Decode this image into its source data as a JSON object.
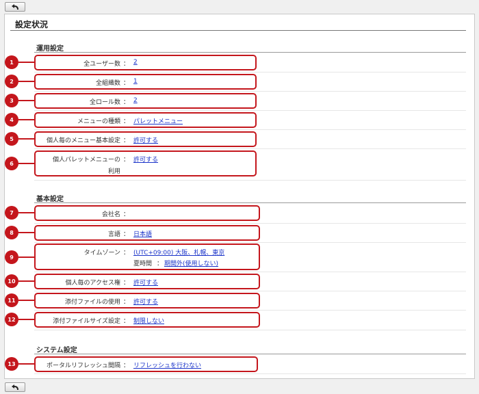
{
  "page_title": "設定状況",
  "sections": {
    "operation": "運用設定",
    "basic": "基本設定",
    "system": "システム設定"
  },
  "items": [
    {
      "num": "1",
      "label": "全ユーザー数",
      "value": "2"
    },
    {
      "num": "2",
      "label": "全組織数",
      "value": "1"
    },
    {
      "num": "3",
      "label": "全ロール数",
      "value": "2"
    },
    {
      "num": "4",
      "label": "メニューの種類",
      "value": "パレットメニュー"
    },
    {
      "num": "5",
      "label": "個人毎のメニュー基本設定",
      "value": "許可する"
    },
    {
      "num": "6",
      "label_line1": "個人パレットメニューの",
      "label_line2": "利用",
      "value": "許可する"
    },
    {
      "num": "7",
      "label": "会社名",
      "value": ""
    },
    {
      "num": "8",
      "label": "言語",
      "value": "日本語"
    },
    {
      "num": "9",
      "label": "タイムゾーン",
      "value": "(UTC+09:00) 大阪、札幌、東京",
      "sub_label": "夏時間",
      "sub_value": "期間外(使用しない)"
    },
    {
      "num": "10",
      "label": "個人毎のアクセス権",
      "value": "許可する"
    },
    {
      "num": "11",
      "label": "添付ファイルの使用",
      "value": "許可する"
    },
    {
      "num": "12",
      "label": "添付ファイルサイズ設定",
      "value": "制限しない"
    },
    {
      "num": "13",
      "label": "ポータルリフレッシュ間隔",
      "value": "リフレッシュを行わない"
    }
  ],
  "colon": "：",
  "icons": {
    "back": "back-arrow-icon"
  },
  "colors": {
    "marker": "#c4161c",
    "link": "#1a33c9"
  }
}
